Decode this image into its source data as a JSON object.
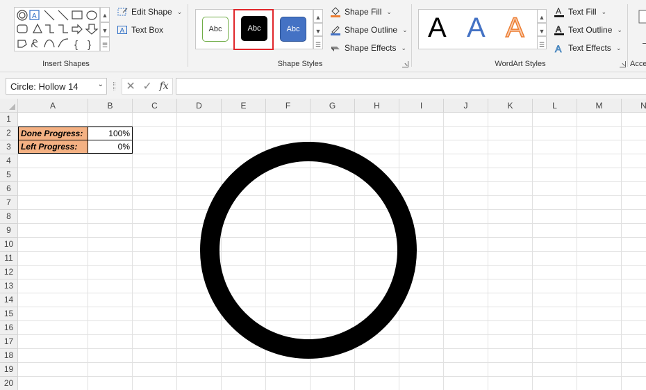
{
  "ribbon": {
    "insert_shapes": {
      "label": "Insert Shapes",
      "edit_shape": "Edit Shape",
      "text_box": "Text Box"
    },
    "shape_styles": {
      "label": "Shape Styles",
      "tiles": [
        "Abc",
        "Abc",
        "Abc"
      ],
      "shape_fill": "Shape Fill",
      "shape_outline": "Shape Outline",
      "shape_effects": "Shape Effects"
    },
    "wordart_styles": {
      "label": "WordArt Styles",
      "letters": [
        "A",
        "A",
        "A"
      ],
      "text_fill": "Text Fill",
      "text_outline": "Text Outline",
      "text_effects": "Text Effects"
    },
    "accessibility": {
      "label": "Acce"
    }
  },
  "formula_bar": {
    "name_box": "Circle: Hollow 14",
    "fx": "fx",
    "formula": ""
  },
  "sheet": {
    "columns": [
      "A",
      "B",
      "C",
      "D",
      "E",
      "F",
      "G",
      "H",
      "I",
      "J",
      "K",
      "L",
      "M",
      "N"
    ],
    "rows": [
      "1",
      "2",
      "3",
      "4",
      "5",
      "6",
      "7",
      "8",
      "9",
      "10",
      "11",
      "12",
      "13",
      "14",
      "15",
      "16",
      "17",
      "18",
      "19",
      "20"
    ],
    "cells": {
      "a2": "Done Progress:",
      "b2": "100%",
      "a3": "Left Progress:",
      "b3": "0%"
    }
  },
  "colors": {
    "label_fill": "#f4b183",
    "ring": "#000000",
    "highlight": "#e0262b",
    "accent_blue": "#4472c4",
    "accent_orange": "#ed7d31"
  }
}
